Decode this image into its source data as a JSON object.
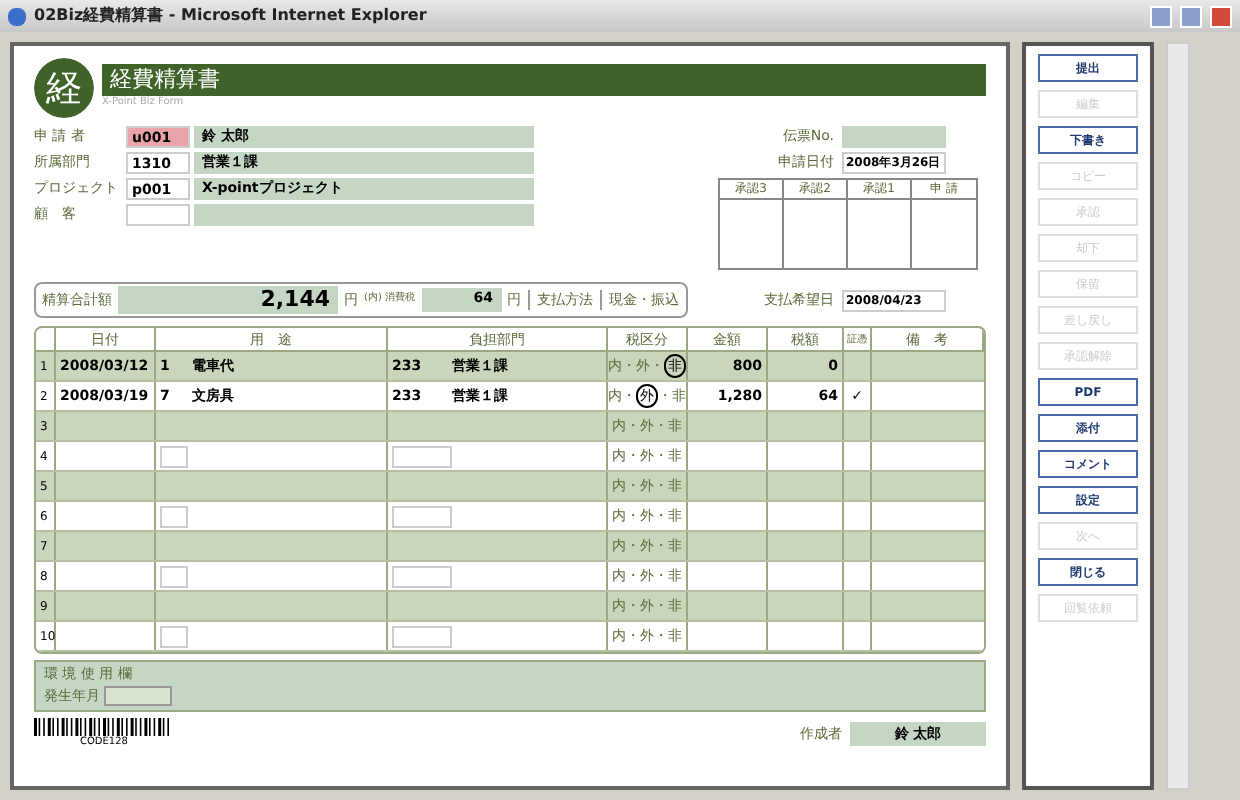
{
  "window": {
    "title": "02Biz経費精算書 - Microsoft Internet Explorer"
  },
  "form": {
    "logo": "経",
    "title": "経費精算書",
    "subtitle": "X-Point Biz Form",
    "applicant": [
      {
        "label": "申 請 者",
        "code": "u001",
        "name": "鈴 太郎",
        "highlight": true
      },
      {
        "label": "所属部門",
        "code": "1310",
        "name": "営業１課",
        "highlight": false
      },
      {
        "label": "プロジェクト",
        "code": "p001",
        "name": "X-pointプロジェクト",
        "highlight": false
      },
      {
        "label": "顧　客",
        "highlight": false
      }
    ],
    "voucher_no": {
      "label": "伝票No."
    },
    "apply_date": {
      "label": "申請日付",
      "value": "2008年3月26日"
    },
    "approvals": [
      "承認3",
      "承認2",
      "承認1",
      "申 請"
    ],
    "total": {
      "label": "精算合計額",
      "value": "2,144",
      "unit": "円",
      "tax_label": "(内) 消費税",
      "tax": "64",
      "tax_unit": "円",
      "method_label": "支払方法",
      "method": "現金・振込"
    },
    "pay_date": {
      "label": "支払希望日",
      "value": "2008/04/23"
    },
    "columns": [
      "日付",
      "用　途",
      "負担部門",
      "税区分",
      "金額",
      "税額",
      "証憑",
      "備　考"
    ],
    "rows": [
      {
        "no": "1",
        "date": "2008/03/12",
        "use_code": "1",
        "use": "電車代",
        "dept_code": "233",
        "dept": "営業１課",
        "tax_options": [
          {
            "label": "内・",
            "selected": false
          },
          {
            "label": "外・",
            "selected": false
          },
          {
            "label": "非",
            "selected": true
          }
        ],
        "amount": "800",
        "tax": "0",
        "receipt": ""
      },
      {
        "no": "2",
        "date": "2008/03/19",
        "use_code": "7",
        "use": "文房具",
        "dept_code": "233",
        "dept": "営業１課",
        "tax_options": [
          {
            "label": "内・",
            "selected": false
          },
          {
            "label": "外",
            "selected": true
          },
          {
            "label": "・非",
            "selected": false
          }
        ],
        "amount": "1,280",
        "tax": "64",
        "receipt": "✓"
      },
      {
        "no": "3",
        "tax_options": [
          {
            "label": "内・",
            "selected": false
          },
          {
            "label": "外・",
            "selected": false
          },
          {
            "label": "非",
            "selected": false
          }
        ]
      },
      {
        "no": "4",
        "tax_options": [
          {
            "label": "内・",
            "selected": false
          },
          {
            "label": "外・",
            "selected": false
          },
          {
            "label": "非",
            "selected": false
          }
        ]
      },
      {
        "no": "5",
        "tax_options": [
          {
            "label": "内・",
            "selected": false
          },
          {
            "label": "外・",
            "selected": false
          },
          {
            "label": "非",
            "selected": false
          }
        ]
      },
      {
        "no": "6",
        "tax_options": [
          {
            "label": "内・",
            "selected": false
          },
          {
            "label": "外・",
            "selected": false
          },
          {
            "label": "非",
            "selected": false
          }
        ]
      },
      {
        "no": "7",
        "tax_options": [
          {
            "label": "内・",
            "selected": false
          },
          {
            "label": "外・",
            "selected": false
          },
          {
            "label": "非",
            "selected": false
          }
        ]
      },
      {
        "no": "8",
        "tax_options": [
          {
            "label": "内・",
            "selected": false
          },
          {
            "label": "外・",
            "selected": false
          },
          {
            "label": "非",
            "selected": false
          }
        ]
      },
      {
        "no": "9",
        "tax_options": [
          {
            "label": "内・",
            "selected": false
          },
          {
            "label": "外・",
            "selected": false
          },
          {
            "label": "非",
            "selected": false
          }
        ]
      },
      {
        "no": "10",
        "tax_options": [
          {
            "label": "内・",
            "selected": false
          },
          {
            "label": "外・",
            "selected": false
          },
          {
            "label": "非",
            "selected": false
          }
        ]
      }
    ],
    "env": {
      "title": "環 境 使 用 欄",
      "field_label": "発生年月"
    },
    "barcode": "CODE128",
    "author": {
      "label": "作成者",
      "value": "鈴 太郎"
    }
  },
  "actions": [
    {
      "label": "提出",
      "disabled": false
    },
    {
      "label": "編集",
      "disabled": true
    },
    {
      "label": "下書き",
      "disabled": false
    },
    {
      "label": "コピー",
      "disabled": true
    },
    {
      "label": "承認",
      "disabled": true
    },
    {
      "label": "却下",
      "disabled": true
    },
    {
      "label": "保留",
      "disabled": true
    },
    {
      "label": "差し戻し",
      "disabled": true
    },
    {
      "label": "承認解除",
      "disabled": true
    },
    {
      "label": "PDF",
      "disabled": false
    },
    {
      "label": "添付",
      "disabled": false
    },
    {
      "label": "コメント",
      "disabled": false
    },
    {
      "label": "設定",
      "disabled": false
    },
    {
      "label": "次へ",
      "disabled": true
    },
    {
      "label": "閉じる",
      "disabled": false
    },
    {
      "label": "回覧依頼",
      "disabled": true
    }
  ]
}
